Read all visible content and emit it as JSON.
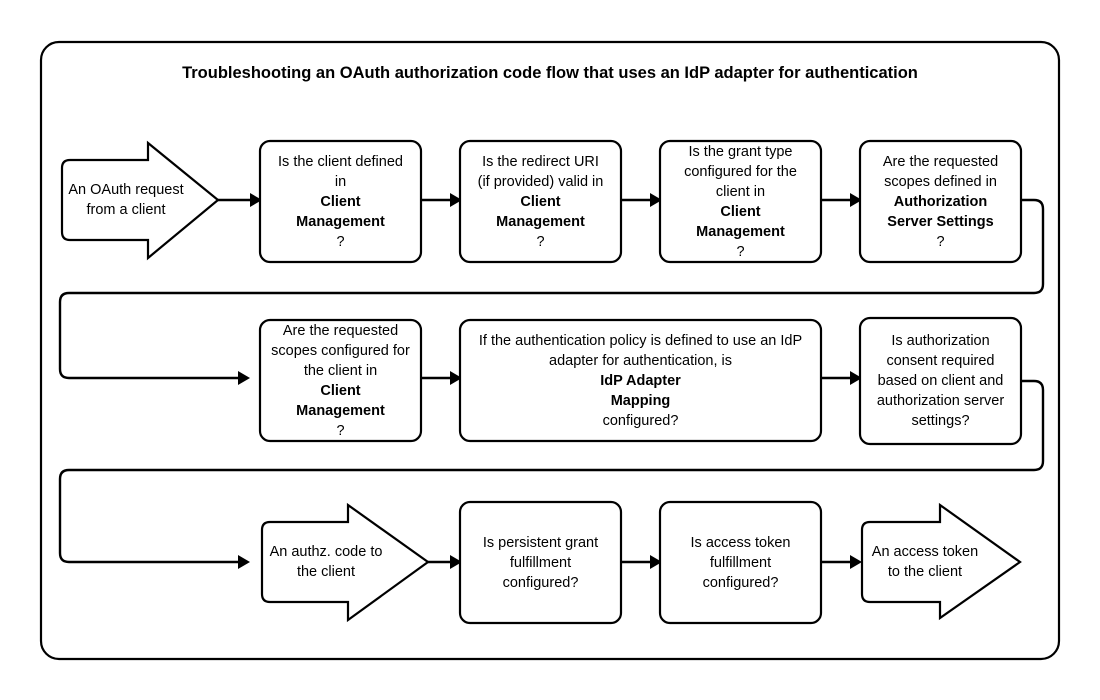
{
  "diagram": {
    "title": "Troubleshooting an OAuth authorization code flow that uses an IdP adapter for authentication",
    "frame_color": "#000000",
    "node_fill": "#ffffff",
    "node_stroke": "#000000",
    "connector_color": "#000000",
    "rows": [
      {
        "row_index": 1,
        "nodes": [
          {
            "id": "oauth-request",
            "shape": "arrow-right",
            "lines": [
              [
                {
                  "t": "An OAuth request",
                  "b": false
                }
              ],
              [
                {
                  "t": "from a client",
                  "b": false
                }
              ]
            ]
          },
          {
            "id": "client-defined",
            "shape": "rounded-rect",
            "lines": [
              [
                {
                  "t": "Is the client defined",
                  "b": false
                }
              ],
              [
                {
                  "t": "in ",
                  "b": false
                },
                {
                  "t": "Client",
                  "b": true
                }
              ],
              [
                {
                  "t": "Management",
                  "b": true
                },
                {
                  "t": "?",
                  "b": false
                }
              ]
            ]
          },
          {
            "id": "redirect-uri-valid",
            "shape": "rounded-rect",
            "lines": [
              [
                {
                  "t": "Is the redirect URI",
                  "b": false
                }
              ],
              [
                {
                  "t": "(if provided) valid in",
                  "b": false
                }
              ],
              [
                {
                  "t": "Client",
                  "b": true
                }
              ],
              [
                {
                  "t": "Management",
                  "b": true
                },
                {
                  "t": "?",
                  "b": false
                }
              ]
            ]
          },
          {
            "id": "grant-type-configured",
            "shape": "rounded-rect",
            "lines": [
              [
                {
                  "t": "Is the grant type",
                  "b": false
                }
              ],
              [
                {
                  "t": "configured for the",
                  "b": false
                }
              ],
              [
                {
                  "t": "client in ",
                  "b": false
                },
                {
                  "t": "Client",
                  "b": true
                }
              ],
              [
                {
                  "t": "Management",
                  "b": true
                },
                {
                  "t": "?",
                  "b": false
                }
              ]
            ]
          },
          {
            "id": "scopes-defined-auth-server",
            "shape": "rounded-rect",
            "lines": [
              [
                {
                  "t": "Are the requested",
                  "b": false
                }
              ],
              [
                {
                  "t": "scopes defined in",
                  "b": false
                }
              ],
              [
                {
                  "t": "Authorization",
                  "b": true
                }
              ],
              [
                {
                  "t": "Server Settings",
                  "b": true
                },
                {
                  "t": "?",
                  "b": false
                }
              ]
            ]
          }
        ]
      },
      {
        "row_index": 2,
        "nodes": [
          {
            "id": "scopes-configured-client",
            "shape": "rounded-rect",
            "lines": [
              [
                {
                  "t": "Are the requested",
                  "b": false
                }
              ],
              [
                {
                  "t": "scopes configured for",
                  "b": false
                }
              ],
              [
                {
                  "t": "the client in ",
                  "b": false
                },
                {
                  "t": "Client",
                  "b": true
                }
              ],
              [
                {
                  "t": "Management",
                  "b": true
                },
                {
                  "t": "?",
                  "b": false
                }
              ]
            ]
          },
          {
            "id": "idp-adapter-mapping",
            "shape": "rounded-rect",
            "lines": [
              [
                {
                  "t": "If the authentication policy is defined to use an IdP",
                  "b": false
                }
              ],
              [
                {
                  "t": "adapter for authentication, is ",
                  "b": false
                },
                {
                  "t": "IdP Adapter",
                  "b": true
                }
              ],
              [
                {
                  "t": "Mapping",
                  "b": true
                },
                {
                  "t": "  configured?",
                  "b": false
                }
              ]
            ]
          },
          {
            "id": "authorization-consent-required",
            "shape": "rounded-rect",
            "lines": [
              [
                {
                  "t": "Is authorization",
                  "b": false
                }
              ],
              [
                {
                  "t": "consent required",
                  "b": false
                }
              ],
              [
                {
                  "t": "based on client and",
                  "b": false
                }
              ],
              [
                {
                  "t": "authorization server",
                  "b": false
                }
              ],
              [
                {
                  "t": "settings?",
                  "b": false
                }
              ]
            ]
          }
        ]
      },
      {
        "row_index": 3,
        "nodes": [
          {
            "id": "authz-code-to-client",
            "shape": "arrow-right",
            "lines": [
              [
                {
                  "t": "An authz. code to",
                  "b": false
                }
              ],
              [
                {
                  "t": "the client",
                  "b": false
                }
              ]
            ]
          },
          {
            "id": "persistent-grant-fulfillment",
            "shape": "rounded-rect",
            "lines": [
              [
                {
                  "t": "Is persistent grant",
                  "b": false
                }
              ],
              [
                {
                  "t": "fulfillment",
                  "b": false
                }
              ],
              [
                {
                  "t": "configured?",
                  "b": false
                }
              ]
            ]
          },
          {
            "id": "access-token-fulfillment",
            "shape": "rounded-rect",
            "lines": [
              [
                {
                  "t": "Is access token",
                  "b": false
                }
              ],
              [
                {
                  "t": "fulfillment",
                  "b": false
                }
              ],
              [
                {
                  "t": "configured?",
                  "b": false
                }
              ]
            ]
          },
          {
            "id": "access-token-to-client",
            "shape": "arrow-right",
            "lines": [
              [
                {
                  "t": "An access token",
                  "b": false
                }
              ],
              [
                {
                  "t": "to the client",
                  "b": false
                }
              ]
            ]
          }
        ]
      }
    ]
  }
}
